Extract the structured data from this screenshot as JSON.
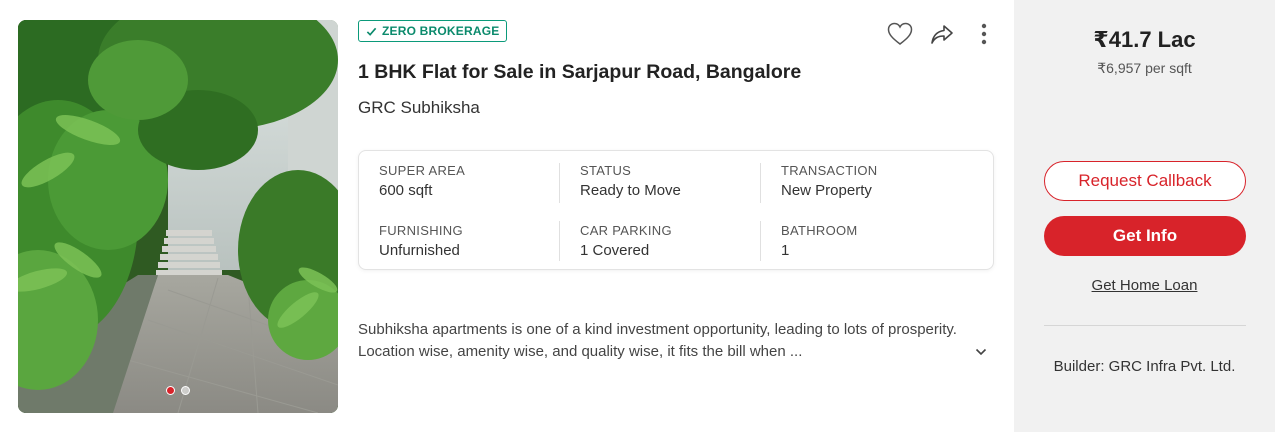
{
  "listing": {
    "badge": "ZERO BROKERAGE",
    "title": "1 BHK Flat for Sale in Sarjapur Road, Bangalore",
    "project": "GRC Subhiksha",
    "description": "Subhiksha apartments is one of a kind investment opportunity, leading to lots of prosperity. Location wise, amenity wise, and quality wise, it fits the bill when ...",
    "carousel": {
      "count": 2,
      "active_index": 0
    },
    "specs": [
      {
        "label": "SUPER AREA",
        "value": "600 sqft"
      },
      {
        "label": "STATUS",
        "value": "Ready to Move"
      },
      {
        "label": "TRANSACTION",
        "value": "New Property"
      },
      {
        "label": "FURNISHING",
        "value": "Unfurnished"
      },
      {
        "label": "CAR PARKING",
        "value": "1 Covered"
      },
      {
        "label": "BATHROOM",
        "value": "1"
      }
    ],
    "icons": {
      "favorite": "heart-icon",
      "share": "share-icon",
      "more": "more-vertical-icon",
      "expand": "chevron-down-icon",
      "badge_check": "check-icon"
    }
  },
  "pricing": {
    "price": "₹41.7 Lac",
    "per_sqft": "₹6,957 per sqft",
    "request_callback": "Request Callback",
    "get_info": "Get Info",
    "home_loan": "Get Home Loan",
    "builder": "Builder: GRC Infra Pvt. Ltd."
  },
  "colors": {
    "accent": "#d8232a",
    "badge": "#0b8a6c",
    "side_panel": "#f1f1f1"
  }
}
